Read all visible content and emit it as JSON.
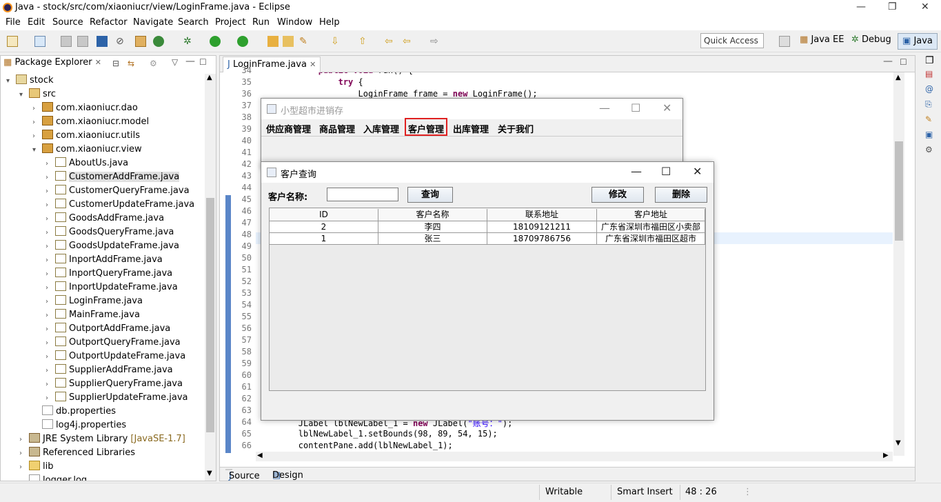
{
  "window": {
    "title": "Java - stock/src/com/xiaoniucr/view/LoginFrame.java - Eclipse"
  },
  "menu": [
    "File",
    "Edit",
    "Source",
    "Refactor",
    "Navigate",
    "Search",
    "Project",
    "Run",
    "Window",
    "Help"
  ],
  "toolbar": {
    "quick_access": "Quick Access"
  },
  "perspectives": {
    "java_ee": "Java EE",
    "debug": "Debug",
    "java": "Java"
  },
  "package_explorer": {
    "tab": "Package Explorer",
    "items": [
      {
        "label": "stock",
        "depth": 0,
        "arrow": "▾",
        "icon": "project-icon"
      },
      {
        "label": "src",
        "depth": 1,
        "arrow": "▾",
        "icon": "src-folder-icon"
      },
      {
        "label": "com.xiaoniucr.dao",
        "depth": 2,
        "arrow": "›",
        "icon": "package-icon"
      },
      {
        "label": "com.xiaoniucr.model",
        "depth": 2,
        "arrow": "›",
        "icon": "package-icon"
      },
      {
        "label": "com.xiaoniucr.utils",
        "depth": 2,
        "arrow": "›",
        "icon": "package-icon"
      },
      {
        "label": "com.xiaoniucr.view",
        "depth": 2,
        "arrow": "▾",
        "icon": "package-icon"
      },
      {
        "label": "AboutUs.java",
        "depth": 3,
        "arrow": "›",
        "icon": "java-file-icon"
      },
      {
        "label": "CustomerAddFrame.java",
        "depth": 3,
        "arrow": "›",
        "icon": "java-file-icon",
        "selected": true
      },
      {
        "label": "CustomerQueryFrame.java",
        "depth": 3,
        "arrow": "›",
        "icon": "java-file-icon"
      },
      {
        "label": "CustomerUpdateFrame.java",
        "depth": 3,
        "arrow": "›",
        "icon": "java-file-icon"
      },
      {
        "label": "GoodsAddFrame.java",
        "depth": 3,
        "arrow": "›",
        "icon": "java-file-icon"
      },
      {
        "label": "GoodsQueryFrame.java",
        "depth": 3,
        "arrow": "›",
        "icon": "java-file-icon"
      },
      {
        "label": "GoodsUpdateFrame.java",
        "depth": 3,
        "arrow": "›",
        "icon": "java-file-icon"
      },
      {
        "label": "InportAddFrame.java",
        "depth": 3,
        "arrow": "›",
        "icon": "java-file-icon"
      },
      {
        "label": "InportQueryFrame.java",
        "depth": 3,
        "arrow": "›",
        "icon": "java-file-icon"
      },
      {
        "label": "InportUpdateFrame.java",
        "depth": 3,
        "arrow": "›",
        "icon": "java-file-icon"
      },
      {
        "label": "LoginFrame.java",
        "depth": 3,
        "arrow": "›",
        "icon": "java-file-icon"
      },
      {
        "label": "MainFrame.java",
        "depth": 3,
        "arrow": "›",
        "icon": "java-file-icon"
      },
      {
        "label": "OutportAddFrame.java",
        "depth": 3,
        "arrow": "›",
        "icon": "java-file-icon"
      },
      {
        "label": "OutportQueryFrame.java",
        "depth": 3,
        "arrow": "›",
        "icon": "java-file-icon"
      },
      {
        "label": "OutportUpdateFrame.java",
        "depth": 3,
        "arrow": "›",
        "icon": "java-file-icon"
      },
      {
        "label": "SupplierAddFrame.java",
        "depth": 3,
        "arrow": "›",
        "icon": "java-file-icon"
      },
      {
        "label": "SupplierQueryFrame.java",
        "depth": 3,
        "arrow": "›",
        "icon": "java-file-icon"
      },
      {
        "label": "SupplierUpdateFrame.java",
        "depth": 3,
        "arrow": "›",
        "icon": "java-file-icon"
      },
      {
        "label": "db.properties",
        "depth": 2,
        "arrow": "",
        "icon": "properties-file-icon"
      },
      {
        "label": "log4j.properties",
        "depth": 2,
        "arrow": "",
        "icon": "properties-file-icon"
      },
      {
        "label": "JRE System Library",
        "suffix": " [JavaSE-1.7]",
        "depth": 1,
        "arrow": "›",
        "icon": "library-icon"
      },
      {
        "label": "Referenced Libraries",
        "depth": 1,
        "arrow": "›",
        "icon": "library-icon"
      },
      {
        "label": "lib",
        "depth": 1,
        "arrow": "›",
        "icon": "folder-icon"
      },
      {
        "label": "logger.log",
        "depth": 1,
        "arrow": "",
        "icon": "file-icon"
      }
    ]
  },
  "editor": {
    "tab": "LoginFrame.java",
    "line_numbers": [
      "34",
      "35",
      "36",
      "37",
      "38",
      "39",
      "40",
      "41",
      "42",
      "43",
      "44",
      "45",
      "46",
      "47",
      "48",
      "49",
      "50",
      "51",
      "52",
      "53",
      "54",
      "55",
      "56",
      "57",
      "58",
      "59",
      "60",
      "61",
      "62",
      "63",
      "64",
      "65",
      "66"
    ],
    "code": [
      {
        "line": "34",
        "text": "            public void run() {"
      },
      {
        "line": "35",
        "text": "                try {"
      },
      {
        "line": "36",
        "text": "                    LoginFrame frame = new LoginFrame();"
      },
      {
        "line": "64",
        "text": "        JLabel lblNewLabel_1 = new JLabel(\"账号：\");"
      },
      {
        "line": "65",
        "text": "        lblNewLabel_1.setBounds(98, 89, 54, 15);"
      },
      {
        "line": "66",
        "text": "        contentPane.add(lblNewLabel_1);"
      }
    ],
    "bottom_tabs": {
      "source": "Source",
      "design": "Design"
    }
  },
  "status": {
    "writable": "Writable",
    "insert": "Smart Insert",
    "position": "48 : 26"
  },
  "main_frame": {
    "title": "小型超市进销存",
    "menus": [
      "供应商管理",
      "商品管理",
      "入库管理",
      "客户管理",
      "出库管理",
      "关于我们"
    ],
    "highlighted_menu": "客户管理"
  },
  "customer_query": {
    "title": "客户查询",
    "name_label": "客户名称:",
    "name_value": "",
    "query_button": "查询",
    "edit_button": "修改",
    "delete_button": "删除",
    "columns": [
      "ID",
      "客户名称",
      "联系地址",
      "客户地址"
    ],
    "rows": [
      [
        "2",
        "李四",
        "18109121211",
        "广东省深圳市福田区小卖部"
      ],
      [
        "1",
        "张三",
        "18709786756",
        "广东省深圳市福田区超市"
      ]
    ]
  }
}
